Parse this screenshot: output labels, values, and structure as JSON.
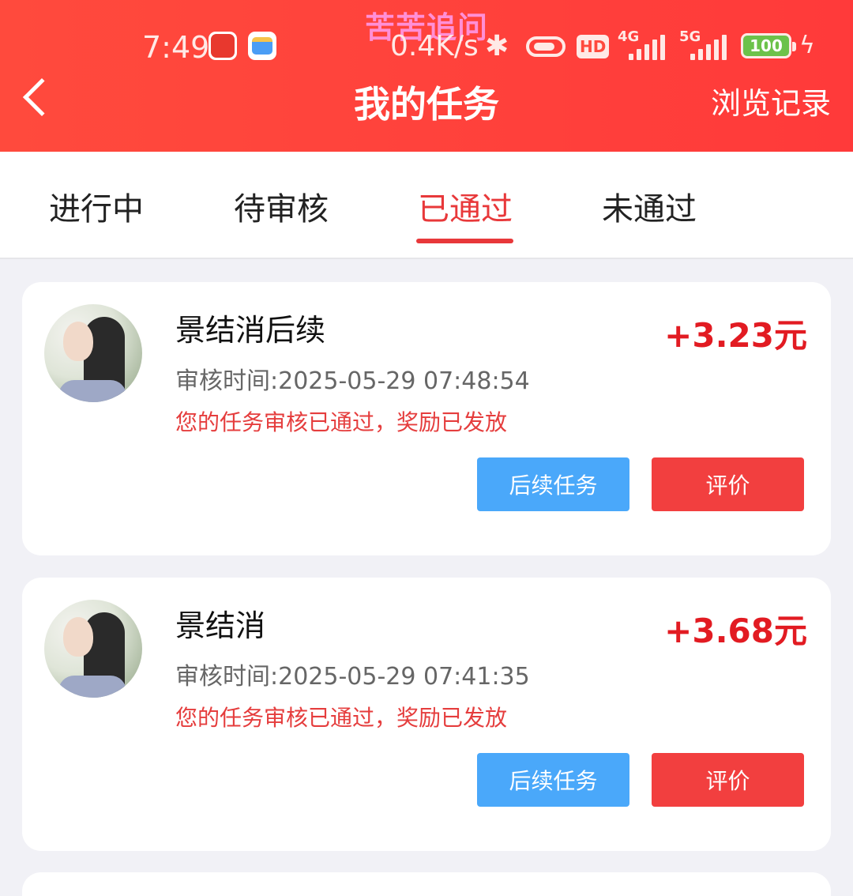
{
  "watermark": "苦苦追问",
  "status_bar": {
    "time": "7:49",
    "net_speed": "0.4K/s",
    "hd_label": "HD",
    "signal1_label": "4G",
    "signal2_label": "5G",
    "battery_level": "100"
  },
  "nav": {
    "title": "我的任务",
    "right_action": "浏览记录"
  },
  "tabs": [
    {
      "label": "进行中",
      "active": false
    },
    {
      "label": "待审核",
      "active": false
    },
    {
      "label": "已通过",
      "active": true
    },
    {
      "label": "未通过",
      "active": false
    }
  ],
  "tasks": [
    {
      "title": "景结消后续",
      "reward": "+3.23元",
      "review_time": "审核时间:2025-05-29 07:48:54",
      "status_msg": "您的任务审核已通过，奖励已发放",
      "follow_button": "后续任务",
      "review_button": "评价"
    },
    {
      "title": "景结消",
      "reward": "+3.68元",
      "review_time": "审核时间:2025-05-29 07:41:35",
      "status_msg": "您的任务审核已通过，奖励已发放",
      "follow_button": "后续任务",
      "review_button": "评价"
    }
  ],
  "colors": {
    "header_red": "#ff4a3d",
    "accent_red": "#e8383a",
    "reward_red": "#e21b22",
    "follow_blue": "#4aa8fa",
    "review_red": "#f23f3f"
  }
}
